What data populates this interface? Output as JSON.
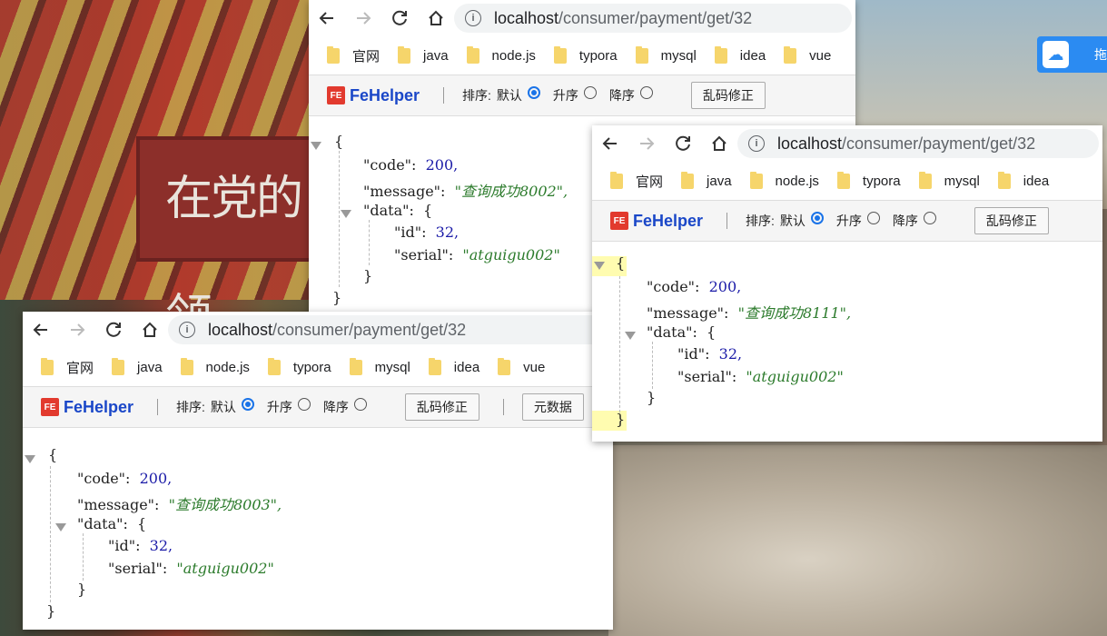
{
  "windows": [
    {
      "url_host": "localhost",
      "url_path": "/consumer/payment/get/32",
      "bookmarks": [
        "官网",
        "java",
        "node.js",
        "typora",
        "mysql",
        "idea",
        "vue"
      ],
      "fehelper": {
        "logo": "FeHelper",
        "sort_label": "排序:",
        "sort_default": "默认",
        "sort_asc": "升序",
        "sort_desc": "降序",
        "fix_button": "乱码修正",
        "extra_button": ""
      },
      "json": {
        "open": "{",
        "code_key": "\"code\":",
        "code_val": "200,",
        "message_key": "\"message\":",
        "message_val": "\"查询成功8002\",",
        "data_key": "\"data\":",
        "data_open": "{",
        "id_key": "\"id\":",
        "id_val": "32,",
        "serial_key": "\"serial\":",
        "serial_val": "\"atguigu002\"",
        "data_close": "}",
        "close": "}"
      }
    },
    {
      "url_host": "localhost",
      "url_path": "/consumer/payment/get/32",
      "bookmarks": [
        "官网",
        "java",
        "node.js",
        "typora",
        "mysql",
        "idea"
      ],
      "fehelper": {
        "logo": "FeHelper",
        "sort_label": "排序:",
        "sort_default": "默认",
        "sort_asc": "升序",
        "sort_desc": "降序",
        "fix_button": "乱码修正",
        "extra_button": ""
      },
      "json": {
        "open": "{",
        "code_key": "\"code\":",
        "code_val": "200,",
        "message_key": "\"message\":",
        "message_val": "\"查询成功8111\",",
        "data_key": "\"data\":",
        "data_open": "{",
        "id_key": "\"id\":",
        "id_val": "32,",
        "serial_key": "\"serial\":",
        "serial_val": "\"atguigu002\"",
        "data_close": "}",
        "close": "}"
      }
    },
    {
      "url_host": "localhost",
      "url_path": "/consumer/payment/get/32",
      "bookmarks": [
        "官网",
        "java",
        "node.js",
        "typora",
        "mysql",
        "idea",
        "vue"
      ],
      "fehelper": {
        "logo": "FeHelper",
        "sort_label": "排序:",
        "sort_default": "默认",
        "sort_asc": "升序",
        "sort_desc": "降序",
        "fix_button": "乱码修正",
        "extra_button": "元数据"
      },
      "json": {
        "open": "{",
        "code_key": "\"code\":",
        "code_val": "200,",
        "message_key": "\"message\":",
        "message_val": "\"查询成功8003\",",
        "data_key": "\"data\":",
        "data_open": "{",
        "id_key": "\"id\":",
        "id_val": "32,",
        "serial_key": "\"serial\":",
        "serial_val": "\"atguigu002\"",
        "data_close": "}",
        "close": "}"
      }
    }
  ],
  "desktop": {
    "sign_text": "在党的领",
    "baidu_text": "拖"
  }
}
